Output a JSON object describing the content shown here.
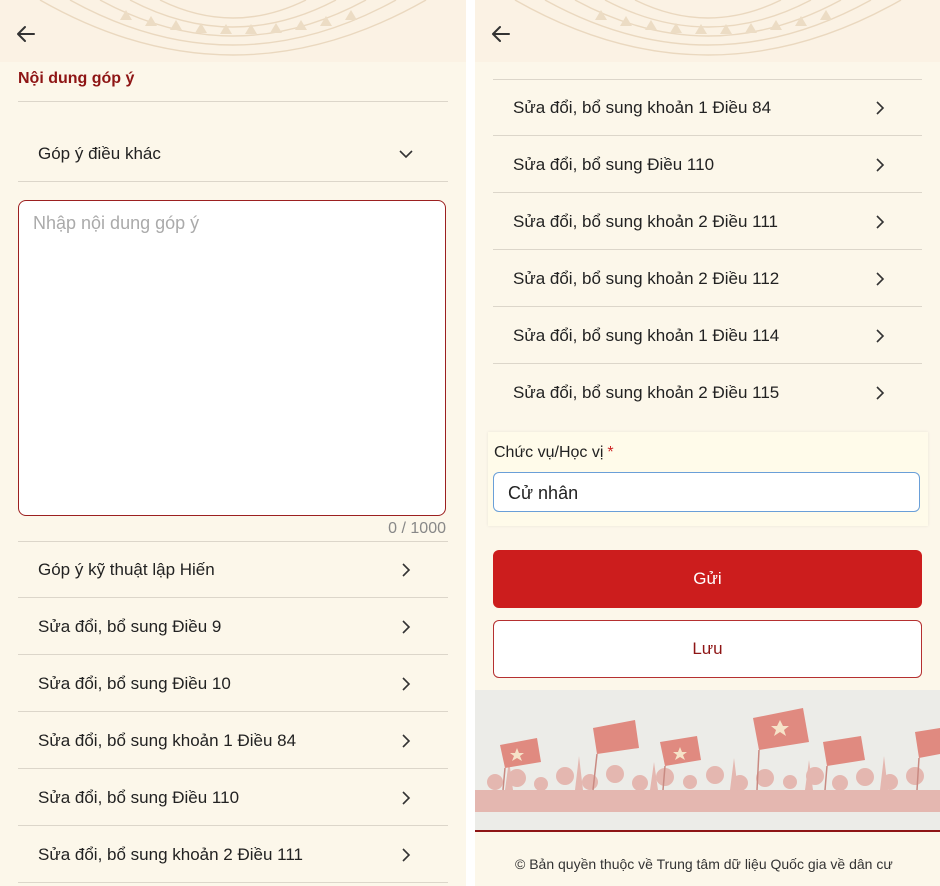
{
  "left": {
    "section_title": "Nội dung góp ý",
    "dropdown_label": "Góp ý điều khác",
    "textarea_placeholder": "Nhập nội dung góp ý",
    "counter": "0 / 1000",
    "items": [
      {
        "label": "Góp ý kỹ thuật lập Hiến"
      },
      {
        "label": "Sửa đổi, bổ sung Điều 9"
      },
      {
        "label": "Sửa đổi, bổ sung Điều 10"
      },
      {
        "label": "Sửa đổi, bổ sung khoản 1 Điều 84"
      },
      {
        "label": "Sửa đổi, bổ sung Điều 110"
      },
      {
        "label": "Sửa đổi, bổ sung khoản 2 Điều 111"
      }
    ]
  },
  "right": {
    "items": [
      {
        "label": "Sửa đổi, bổ sung khoản 1 Điều 84"
      },
      {
        "label": "Sửa đổi, bổ sung Điều 110"
      },
      {
        "label": "Sửa đổi, bổ sung khoản 2 Điều 111"
      },
      {
        "label": "Sửa đổi, bổ sung khoản 2 Điều 112"
      },
      {
        "label": "Sửa đổi, bổ sung khoản 1 Điều 114"
      },
      {
        "label": "Sửa đổi, bổ sung khoản 2 Điều 115"
      }
    ],
    "field_label": "Chức vụ/Học vị",
    "required_mark": "*",
    "field_value": "Cử nhân",
    "send_label": "Gửi",
    "save_label": "Lưu",
    "footer_text": "© Bản quyền thuộc về Trung tâm dữ liệu Quốc gia về dân cư"
  },
  "icons": {
    "back": "arrow-left-icon",
    "dropdown": "chevron-down-icon",
    "row": "chevron-right-icon"
  },
  "colors": {
    "accent_red": "#cc1d1d",
    "title_red": "#8e1515",
    "background": "#fcf7ea",
    "focus_blue": "#6a9fd8"
  }
}
